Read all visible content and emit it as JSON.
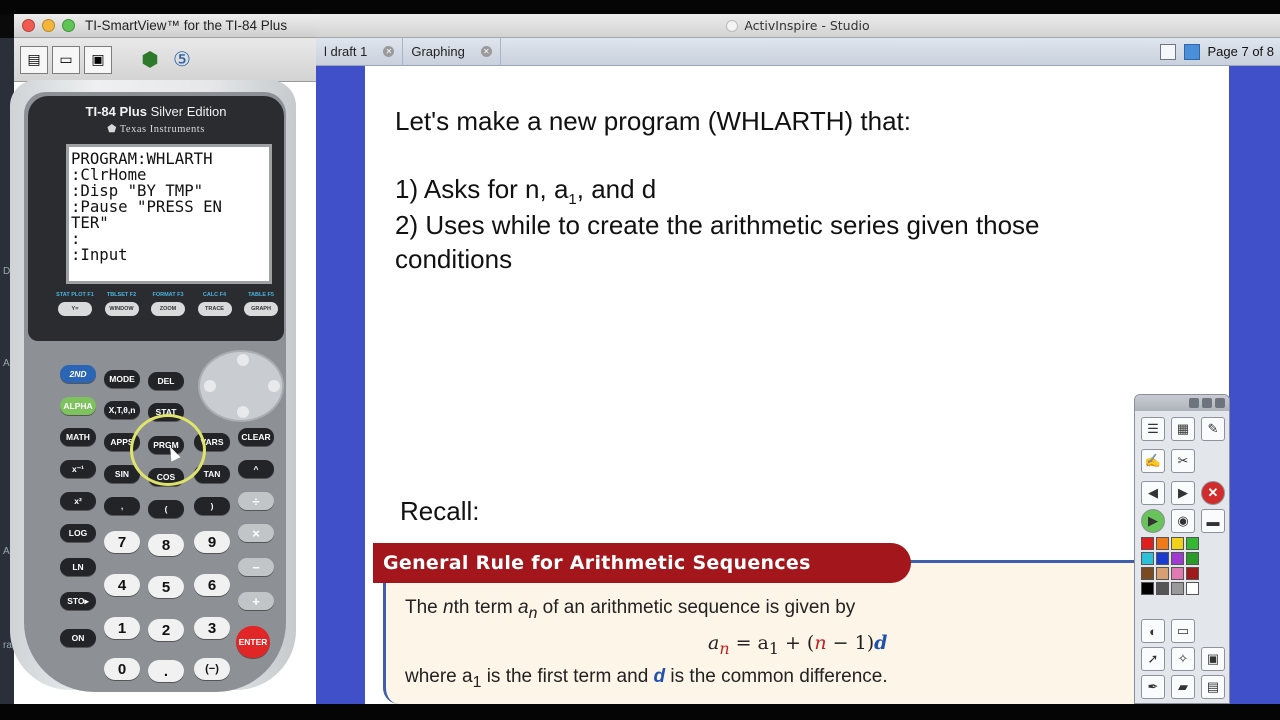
{
  "smartview": {
    "title": "TI-SmartView™ for the TI-84 Plus",
    "toolbar": [
      "open-doc-icon",
      "open-folder-icon",
      "screen-capture-icon",
      "calculator-3d-icon",
      "history-icon"
    ]
  },
  "calculator": {
    "model": "TI-84 Plus",
    "edition": "Silver Edition",
    "brand": "Texas Instruments",
    "screen_lines": [
      "PROGRAM:WHLARTH",
      ":ClrHome",
      ":Disp \"BY TMP\"",
      ":Pause \"PRESS EN",
      "TER\"",
      ":",
      ":Input"
    ],
    "fkeys": [
      {
        "top": "STAT PLOT F1",
        "label": "Y="
      },
      {
        "top": "TBLSET F2",
        "label": "WINDOW"
      },
      {
        "top": "FORMAT F3",
        "label": "ZOOM"
      },
      {
        "top": "CALC F4",
        "label": "TRACE"
      },
      {
        "top": "TABLE F5",
        "label": "GRAPH"
      }
    ],
    "keys": {
      "second": "2ND",
      "mode": "MODE",
      "del": "DEL",
      "alpha": "ALPHA",
      "xton": "X,T,θ,n",
      "stat": "STAT",
      "math": "MATH",
      "apps": "APPS",
      "prgm": "PRGM",
      "vars": "VARS",
      "clear": "CLEAR",
      "inverse": "x⁻¹",
      "sin": "SIN",
      "cos": "COS",
      "tan": "TAN",
      "caret": "^",
      "square": "x²",
      "comma": ",",
      "lparen": "(",
      "rparen": ")",
      "divide": "÷",
      "log": "LOG",
      "n7": "7",
      "n8": "8",
      "n9": "9",
      "times": "×",
      "ln": "LN",
      "n4": "4",
      "n5": "5",
      "n6": "6",
      "minus": "−",
      "sto": "STO▸",
      "n1": "1",
      "n2": "2",
      "n3": "3",
      "plus": "+",
      "on": "ON",
      "n0": "0",
      "dot": ".",
      "neg": "(−)",
      "enter": "ENTER"
    }
  },
  "activinspire": {
    "title": "ActivInspire - Studio",
    "tabs": [
      {
        "label": "l draft 1"
      },
      {
        "label": "Graphing"
      }
    ],
    "page_indicator": "Page 7 of 8",
    "left_strip_letters": [
      "D",
      "A",
      "Al",
      "ra"
    ]
  },
  "slide": {
    "heading": "Let's make a new program (WHLARTH) that:",
    "item1_pre": "1) Asks for n, a",
    "item1_sub": "1",
    "item1_post": ", and d",
    "item2": "2) Uses while to create the arithmetic series given those conditions",
    "recall": "Recall:",
    "rule_title": "General Rule for Arithmetic Sequences",
    "rule_line1_a": "The ",
    "rule_line1_n": "n",
    "rule_line1_b": "th term ",
    "rule_line1_an": "a",
    "rule_line1_sub": "n",
    "rule_line1_c": " of an arithmetic sequence is given by",
    "formula_lhs": "a",
    "formula_lhs_sub": "n",
    "formula_eq": " = a",
    "formula_a1_sub": "1",
    "formula_plus": " + (",
    "formula_n": "n",
    "formula_minus": " − 1)",
    "formula_d": "d",
    "rule_line2_a": "where a",
    "rule_line2_sub": "1",
    "rule_line2_b": " is the first term and ",
    "rule_line2_d": "d",
    "rule_line2_c": " is the common difference."
  },
  "colors": {
    "flipchart_bg": "#3f50c8",
    "banner": "#a2161c",
    "rule_box_bg": "#fdf6e8",
    "accent_blue": "#2151b0",
    "accent_red": "#c41f1f"
  },
  "toolbox": {
    "palette": [
      "#e02020",
      "#f07a1a",
      "#f0d21a",
      "#33b833",
      "#2ec0d8",
      "#1a3ad0",
      "#a03ad0",
      "#2a9a2a",
      "#7a4a20",
      "#d8a070",
      "#e07ab0",
      "#a01a1a",
      "#000000",
      "#555555",
      "#999999",
      "#ffffff"
    ]
  }
}
